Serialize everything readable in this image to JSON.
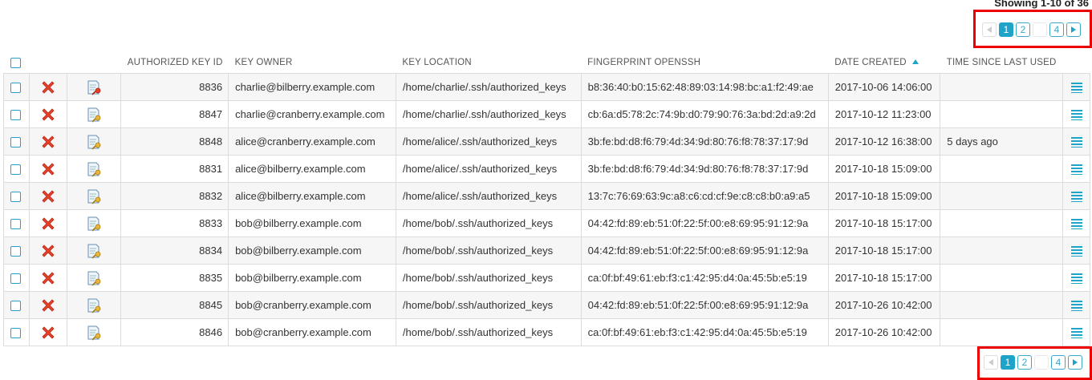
{
  "pagination": {
    "showing": "Showing 1-10 of 36",
    "pages": [
      "1",
      "2",
      "",
      "4"
    ],
    "current": "1"
  },
  "table": {
    "headers": {
      "authorized_key_id": "AUTHORIZED KEY ID",
      "key_owner": "KEY OWNER",
      "key_location": "KEY LOCATION",
      "fingerprint": "FINGERPRINT OPENSSH",
      "date_created": "DATE CREATED",
      "time_since_last_used": "TIME SINCE LAST USED"
    },
    "sorted_by": "date_created",
    "sort_direction": "ascending",
    "rows": [
      {
        "id": "8836",
        "owner": "charlie@bilberry.example.com",
        "location": "/home/charlie/.ssh/authorized_keys",
        "fingerprint": "b8:36:40:b0:15:62:48:89:03:14:98:bc:a1:f2:49:ae",
        "created": "2017-10-06 14:06:00",
        "last_used": "",
        "edit_icon": "edit-key-alert-icon"
      },
      {
        "id": "8847",
        "owner": "charlie@cranberry.example.com",
        "location": "/home/charlie/.ssh/authorized_keys",
        "fingerprint": "cb:6a:d5:78:2c:74:9b:d0:79:90:76:3a:bd:2d:a9:2d",
        "created": "2017-10-12 11:23:00",
        "last_used": "",
        "edit_icon": "edit-key-icon"
      },
      {
        "id": "8848",
        "owner": "alice@cranberry.example.com",
        "location": "/home/alice/.ssh/authorized_keys",
        "fingerprint": "3b:fe:bd:d8:f6:79:4d:34:9d:80:76:f8:78:37:17:9d",
        "created": "2017-10-12 16:38:00",
        "last_used": "5 days ago",
        "edit_icon": "edit-key-icon"
      },
      {
        "id": "8831",
        "owner": "alice@bilberry.example.com",
        "location": "/home/alice/.ssh/authorized_keys",
        "fingerprint": "3b:fe:bd:d8:f6:79:4d:34:9d:80:76:f8:78:37:17:9d",
        "created": "2017-10-18 15:09:00",
        "last_used": "",
        "edit_icon": "edit-key-icon"
      },
      {
        "id": "8832",
        "owner": "alice@bilberry.example.com",
        "location": "/home/alice/.ssh/authorized_keys",
        "fingerprint": "13:7c:76:69:63:9c:a8:c6:cd:cf:9e:c8:c8:b0:a9:a5",
        "created": "2017-10-18 15:09:00",
        "last_used": "",
        "edit_icon": "edit-key-icon"
      },
      {
        "id": "8833",
        "owner": "bob@bilberry.example.com",
        "location": "/home/bob/.ssh/authorized_keys",
        "fingerprint": "04:42:fd:89:eb:51:0f:22:5f:00:e8:69:95:91:12:9a",
        "created": "2017-10-18 15:17:00",
        "last_used": "",
        "edit_icon": "edit-key-icon"
      },
      {
        "id": "8834",
        "owner": "bob@bilberry.example.com",
        "location": "/home/bob/.ssh/authorized_keys",
        "fingerprint": "04:42:fd:89:eb:51:0f:22:5f:00:e8:69:95:91:12:9a",
        "created": "2017-10-18 15:17:00",
        "last_used": "",
        "edit_icon": "edit-key-icon"
      },
      {
        "id": "8835",
        "owner": "bob@bilberry.example.com",
        "location": "/home/bob/.ssh/authorized_keys",
        "fingerprint": "ca:0f:bf:49:61:eb:f3:c1:42:95:d4:0a:45:5b:e5:19",
        "created": "2017-10-18 15:17:00",
        "last_used": "",
        "edit_icon": "edit-key-icon"
      },
      {
        "id": "8845",
        "owner": "bob@cranberry.example.com",
        "location": "/home/bob/.ssh/authorized_keys",
        "fingerprint": "04:42:fd:89:eb:51:0f:22:5f:00:e8:69:95:91:12:9a",
        "created": "2017-10-26 10:42:00",
        "last_used": "",
        "edit_icon": "edit-key-icon"
      },
      {
        "id": "8846",
        "owner": "bob@cranberry.example.com",
        "location": "/home/bob/.ssh/authorized_keys",
        "fingerprint": "ca:0f:bf:49:61:eb:f3:c1:42:95:d4:0a:45:5b:e5:19",
        "created": "2017-10-26 10:42:00",
        "last_used": "",
        "edit_icon": "edit-key-icon"
      }
    ]
  },
  "colors": {
    "accent": "#1ea4c8",
    "delete": "#e8402a",
    "highlight_box": "#ee0000"
  }
}
